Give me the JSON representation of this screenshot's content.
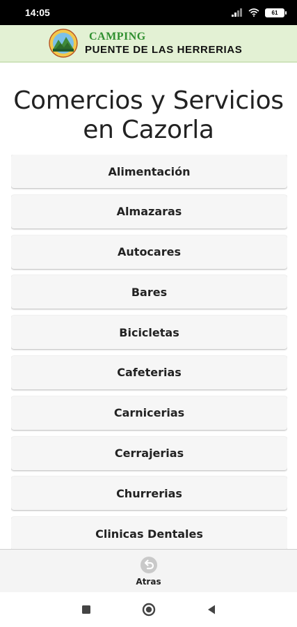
{
  "status_bar": {
    "time": "14:05",
    "battery": "61"
  },
  "header": {
    "brand_top": "CAMPING",
    "brand_bottom": "PUENTE DE LAS HERRERIAS"
  },
  "page": {
    "title_line1": "Comercios y Servicios",
    "title_line2": "en Cazorla"
  },
  "categories": [
    "Alimentación",
    "Almazaras",
    "Autocares",
    "Bares",
    "Bicicletas",
    "Cafeterias",
    "Carnicerias",
    "Cerrajerias",
    "Churrerias",
    "Clinicas Dentales"
  ],
  "bottom_bar": {
    "back_label": "Atras",
    "back_icon": "back-arrow-icon"
  },
  "nav": {
    "recents_icon": "square-icon",
    "home_icon": "circle-icon",
    "back_icon": "triangle-back-icon"
  },
  "colors": {
    "header_bg": "#e3f1d4",
    "brand_green": "#2f8f2f",
    "item_bg": "#f6f6f6"
  }
}
